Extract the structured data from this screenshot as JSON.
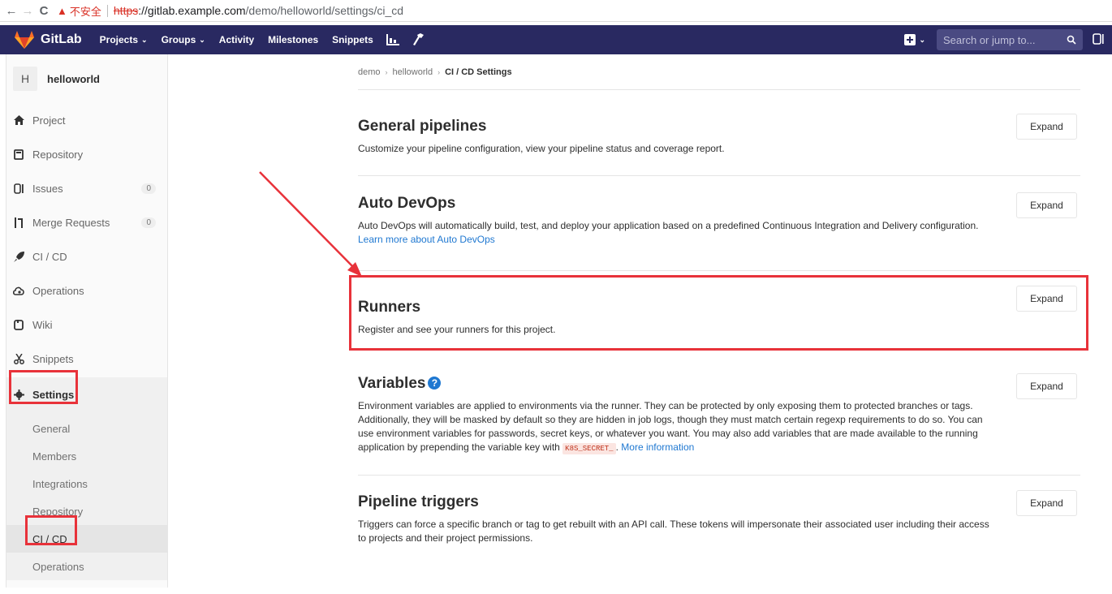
{
  "browser": {
    "back": "←",
    "forward": "→",
    "reload": "C",
    "warning_icon": "▲",
    "warning_text": "不安全",
    "url_scheme": "https",
    "url_rest_host": "://gitlab.example.com",
    "url_path": "/demo/helloworld/settings/ci_cd"
  },
  "navbar": {
    "brand": "GitLab",
    "items": [
      {
        "label": "Projects",
        "caret": "⌄"
      },
      {
        "label": "Groups",
        "caret": "⌄"
      },
      {
        "label": "Activity",
        "caret": ""
      },
      {
        "label": "Milestones",
        "caret": ""
      },
      {
        "label": "Snippets",
        "caret": ""
      }
    ],
    "search_placeholder": "Search or jump to...",
    "bg_color": "#292961"
  },
  "sidebar": {
    "avatar_letter": "H",
    "project_name": "helloworld",
    "items": [
      {
        "label": "Project",
        "icon": "home-icon",
        "badge": ""
      },
      {
        "label": "Repository",
        "icon": "book-icon",
        "badge": ""
      },
      {
        "label": "Issues",
        "icon": "issues-icon",
        "badge": "0"
      },
      {
        "label": "Merge Requests",
        "icon": "merge-request-icon",
        "badge": "0"
      },
      {
        "label": "CI / CD",
        "icon": "rocket-icon",
        "badge": ""
      },
      {
        "label": "Operations",
        "icon": "cloud-gear-icon",
        "badge": ""
      },
      {
        "label": "Wiki",
        "icon": "book-open-icon",
        "badge": ""
      },
      {
        "label": "Snippets",
        "icon": "scissors-icon",
        "badge": ""
      }
    ],
    "settings_label": "Settings",
    "sub_items": [
      "General",
      "Members",
      "Integrations",
      "Repository",
      "CI / CD",
      "Operations"
    ],
    "active_sub": "CI / CD"
  },
  "breadcrumb": {
    "items": [
      "demo",
      "helloworld"
    ],
    "current": "CI / CD Settings"
  },
  "sections": {
    "general": {
      "title": "General pipelines",
      "desc": "Customize your pipeline configuration, view your pipeline status and coverage report.",
      "button": "Expand"
    },
    "autodevops": {
      "title": "Auto DevOps",
      "desc": "Auto DevOps will automatically build, test, and deploy your application based on a predefined Continuous Integration and Delivery configuration.",
      "link": "Learn more about Auto DevOps",
      "button": "Expand"
    },
    "runners": {
      "title": "Runners",
      "desc": "Register and see your runners for this project.",
      "button": "Expand"
    },
    "variables": {
      "title": "Variables",
      "help_icon": "?",
      "desc": "Environment variables are applied to environments via the runner. They can be protected by only exposing them to protected branches or tags. Additionally, they will be masked by default so they are hidden in job logs, though they must match certain regexp requirements to do so. You can use environment variables for passwords, secret keys, or whatever you want. You may also add variables that are made available to the running application by prepending the variable key with",
      "code": "K8S_SECRET_",
      "after_code": ".",
      "link": "More information",
      "button": "Expand"
    },
    "triggers": {
      "title": "Pipeline triggers",
      "desc": "Triggers can force a specific branch or tag to get rebuilt with an API call. These tokens will impersonate their associated user including their access to projects and their project permissions.",
      "button": "Expand"
    }
  },
  "annotation_color": "#e8323a"
}
